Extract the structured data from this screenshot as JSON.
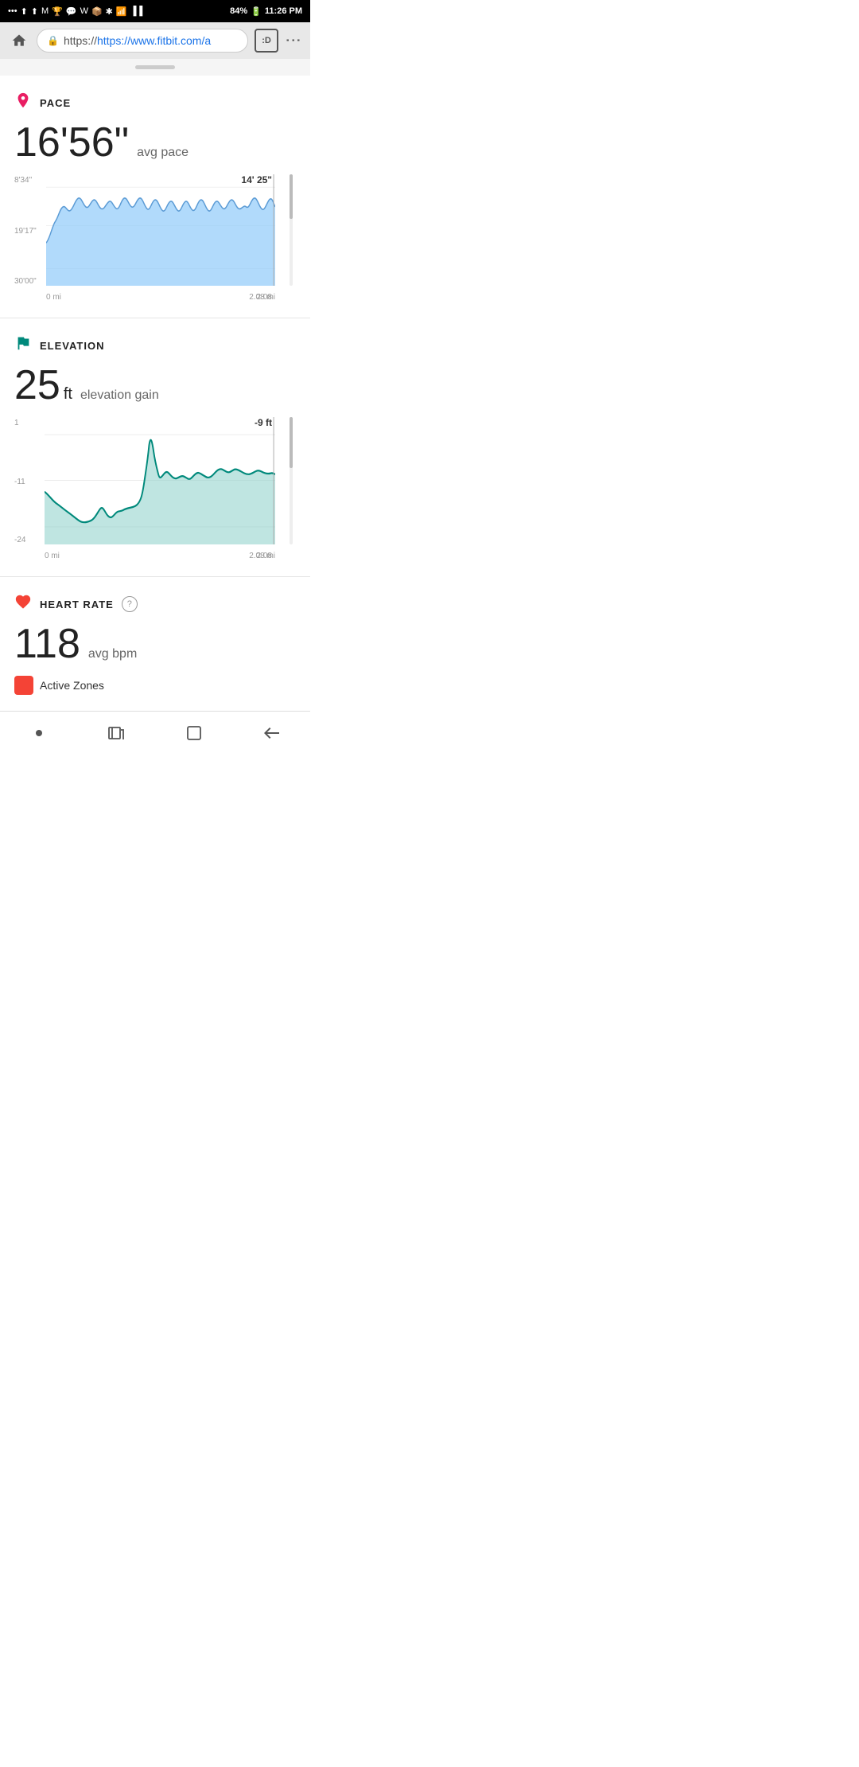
{
  "statusBar": {
    "icons": [
      "...",
      "nav",
      "nav2",
      "gmail",
      "trophy",
      "msg",
      "w",
      "pkg",
      "bt",
      "wifi",
      "signal"
    ],
    "battery": "84%",
    "time": "11:26 PM"
  },
  "browser": {
    "url": "https://www.fitbit.com/a",
    "urlDisplay": "https://www.fitbit.com/a",
    "tabLabel": ":D"
  },
  "pace": {
    "sectionTitle": "PACE",
    "value": "16'56\"",
    "valueMins": "16'",
    "valueSecs": "56\"",
    "subLabel": "avg pace",
    "chartTooltip": "14' 25\"",
    "chartXStart": "0 mi",
    "chartXEnd": "2.08 mi",
    "chartValueEnd": "2.08",
    "chartYLabels": [
      "8'34\"",
      "19'17\"",
      "30'00\""
    ]
  },
  "elevation": {
    "sectionTitle": "ELEVATION",
    "value": "25",
    "unit": "ft",
    "subLabel": "elevation gain",
    "chartTooltip": "-9 ft",
    "chartXStart": "0 mi",
    "chartXEnd": "2.08 mi",
    "chartValueEnd": "2.08",
    "chartYLabels": [
      "1",
      "-11",
      "-24"
    ]
  },
  "heartRate": {
    "sectionTitle": "HEART RATE",
    "helpLabel": "?",
    "value": "118",
    "unit": "avg bpm",
    "badgePartial": "Active Zones"
  },
  "bottomNav": {
    "dot": "●",
    "tabs": "⇥",
    "square": "▢",
    "back": "←"
  }
}
